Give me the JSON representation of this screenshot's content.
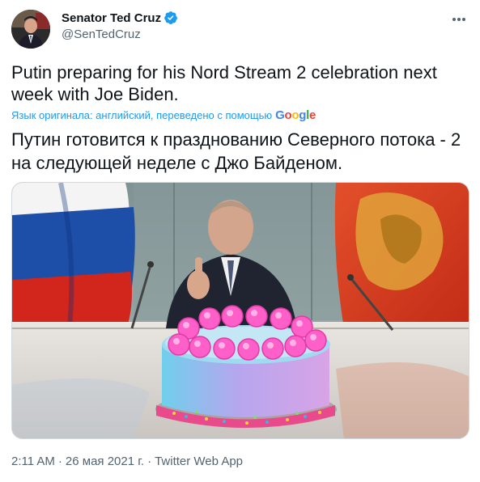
{
  "author": {
    "display_name": "Senator Ted Cruz",
    "handle": "@SenTedCruz",
    "verified": true,
    "avatar_icon": "profile-photo",
    "verified_icon": "verified-badge-icon"
  },
  "tweet": {
    "text": "Putin preparing for his Nord Stream 2 celebration next week with Joe Biden.",
    "translation_note": "Язык оригинала: английский, переведено с помощью",
    "translation_provider": "Google",
    "translated_text": "Путин готовится к празднованию Северного потока - 2 на следующей неделе с Джо Байденом."
  },
  "meta": {
    "time": "2:11 AM",
    "separator": "·",
    "date": "26 мая 2021 г.",
    "source": "Twitter Web App"
  },
  "colors": {
    "accent": "#1d9bf0",
    "text": "#0f1419",
    "muted": "#536471",
    "flag_red": "#d52b1e",
    "flag_blue": "#0039a6",
    "cake_frosting": "#7fd3ea",
    "cake_pink": "#ff5fc8"
  }
}
